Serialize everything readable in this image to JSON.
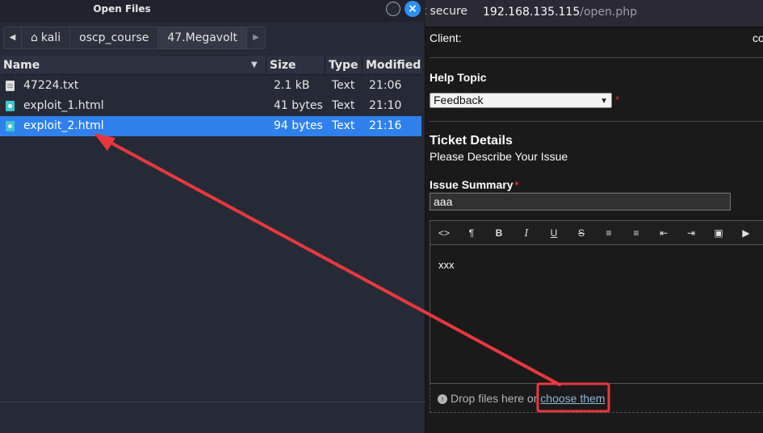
{
  "browser": {
    "not_secure": "ot secure",
    "url_host": "192.168.135.115",
    "url_path": "/open.php"
  },
  "form": {
    "client_label": "Client:",
    "client_value": "co",
    "help_topic_title": "Help Topic",
    "help_topic_selected": "Feedback",
    "required_mark": "*",
    "ticket_details_title": "Ticket Details",
    "ticket_details_subtitle": "Please Describe Your Issue",
    "issue_summary_title": "Issue Summary",
    "issue_summary_value": "aaa",
    "editor_content": "xxx",
    "toolbar_icons": [
      "code-icon",
      "paragraph-icon",
      "bold-icon",
      "italic-icon",
      "underline-icon",
      "strikethrough-icon",
      "bulleted-list-icon",
      "numbered-list-icon",
      "outdent-icon",
      "indent-icon",
      "image-icon",
      "video-icon"
    ],
    "drop_text": "Drop files here or",
    "choose_link": "choose them"
  },
  "dialog": {
    "title": "Open Files",
    "breadcrumbs": [
      "kali",
      "oscp_course",
      "47.Megavolt"
    ],
    "columns": [
      "Name",
      "Size",
      "Type",
      "Modified"
    ],
    "files": [
      {
        "name": "47224.txt",
        "size": "2.1 kB",
        "type": "Text",
        "modified": "21:06",
        "icon": "text-file-icon",
        "selected": false
      },
      {
        "name": "exploit_1.html",
        "size": "41 bytes",
        "type": "Text",
        "modified": "21:10",
        "icon": "html-file-icon",
        "selected": false
      },
      {
        "name": "exploit_2.html",
        "size": "94 bytes",
        "type": "Text",
        "modified": "21:16",
        "icon": "html-file-icon",
        "selected": true
      }
    ]
  },
  "colors": {
    "selection": "#2f80ed",
    "annotation": "#e8383d",
    "link": "#8fb8d8"
  }
}
